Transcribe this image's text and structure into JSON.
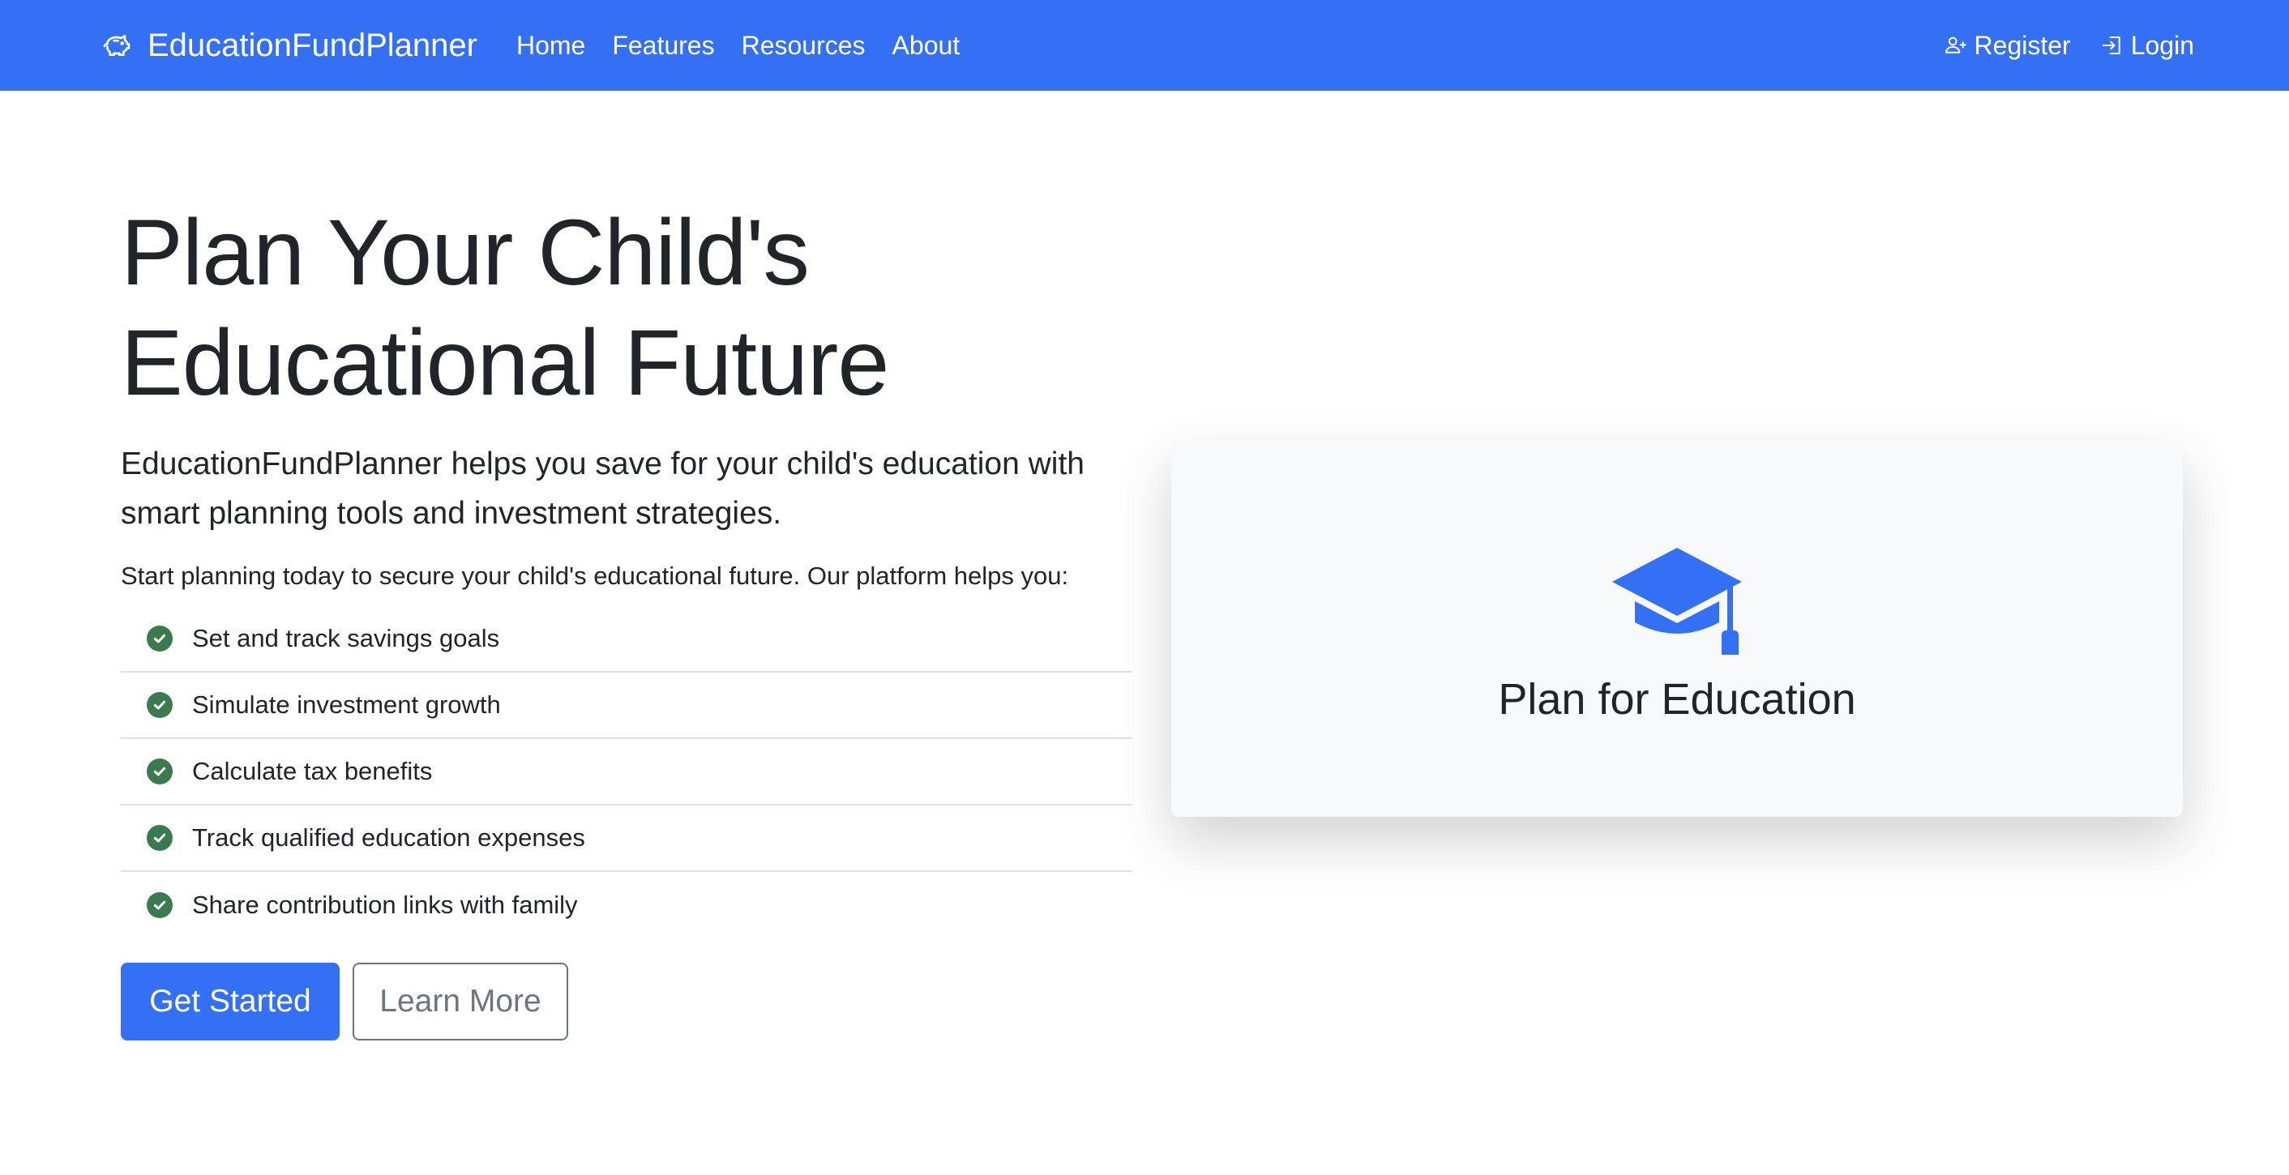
{
  "navbar": {
    "brand": "EducationFundPlanner",
    "brand_icon": "piggy-bank-icon",
    "links": [
      "Home",
      "Features",
      "Resources",
      "About"
    ],
    "register_label": "Register",
    "login_label": "Login",
    "background": "#3470f3"
  },
  "hero": {
    "title_line1": "Plan Your Child's",
    "title_line2": "Educational Future",
    "lead_line1": "EducationFundPlanner helps you save for your child's education with",
    "lead_line2": "smart planning tools and investment strategies.",
    "body": "Start planning today to secure your child's educational future. Our platform helps you:",
    "features": [
      "Set and track savings goals",
      "Simulate investment growth",
      "Calculate tax benefits",
      "Track qualified education expenses",
      "Share contribution links with family"
    ],
    "primary_button": "Get Started",
    "secondary_button": "Learn More"
  },
  "card": {
    "icon": "graduation-cap-icon",
    "title": "Plan for Education"
  },
  "colors": {
    "accent": "#3470f3",
    "check": "#3b7a4d",
    "card_bg": "#f8f9fa"
  }
}
